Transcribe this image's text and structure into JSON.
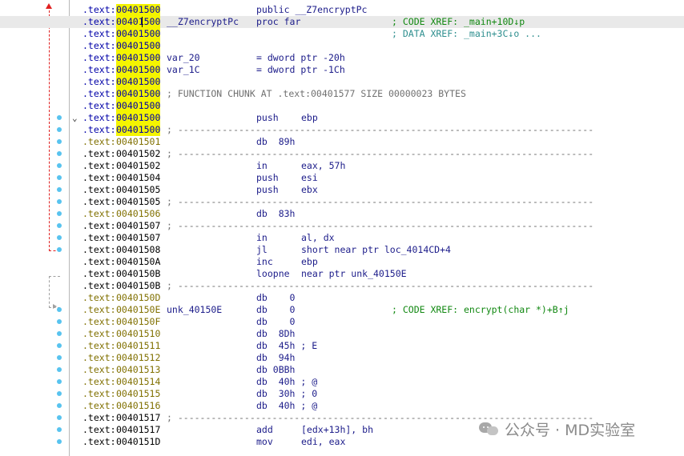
{
  "colors": {
    "highlight": "#f4f400",
    "selected_row": "#e9e9e9",
    "segment_blue": "#0000a8",
    "segment_olive": "#807000",
    "dot": "#58c3ef",
    "flow_arrow": "#e02020"
  },
  "rows": [
    {
      "seg": ".text:",
      "addr": "00401500",
      "hl": true,
      "mn": "public __Z7encryptPc",
      "segc": "blue"
    },
    {
      "seg": ".text:",
      "addr": "00401500",
      "hl": true,
      "sel": true,
      "lbl": "__Z7encryptPc",
      "mn": "proc far",
      "cm": "; CODE XREF: _main+10D↓p",
      "segc": "blue"
    },
    {
      "seg": ".text:",
      "addr": "00401500",
      "hl": true,
      "cm": "; DATA XREF: _main+3C↓o ...",
      "segc": "blue",
      "cmc": "blue"
    },
    {
      "seg": ".text:",
      "addr": "00401500",
      "hl": true,
      "segc": "blue"
    },
    {
      "seg": ".text:",
      "addr": "00401500",
      "hl": true,
      "lbl": "var_20",
      "mn": "= dword ptr -20h",
      "segc": "blue"
    },
    {
      "seg": ".text:",
      "addr": "00401500",
      "hl": true,
      "lbl": "var_1C",
      "mn": "= dword ptr -1Ch",
      "segc": "blue"
    },
    {
      "seg": ".text:",
      "addr": "00401500",
      "hl": true,
      "segc": "blue"
    },
    {
      "seg": ".text:",
      "addr": "00401500",
      "hl": true,
      "sep": "; FUNCTION CHUNK AT .text:00401577 SIZE 00000023 BYTES",
      "segc": "blue"
    },
    {
      "seg": ".text:",
      "addr": "00401500",
      "hl": true,
      "segc": "blue"
    },
    {
      "seg": ".text:",
      "addr": "00401500",
      "hl": true,
      "mn": "push",
      "op": "ebp",
      "segc": "blue"
    },
    {
      "seg": ".text:",
      "addr": "00401500",
      "hl": true,
      "sep": "; ---------------------------------------------------------------------------",
      "segc": "blue"
    },
    {
      "seg": ".text:",
      "addr": "00401501",
      "mn": "db  89h",
      "segc": "olive"
    },
    {
      "seg": ".text:",
      "addr": "00401502",
      "sep": "; ---------------------------------------------------------------------------",
      "segc": "black"
    },
    {
      "seg": ".text:",
      "addr": "00401502",
      "mn": "in",
      "op": "eax, 57h",
      "segc": "black"
    },
    {
      "seg": ".text:",
      "addr": "00401504",
      "mn": "push",
      "op": "esi",
      "segc": "black"
    },
    {
      "seg": ".text:",
      "addr": "00401505",
      "mn": "push",
      "op": "ebx",
      "segc": "black"
    },
    {
      "seg": ".text:",
      "addr": "00401505",
      "sep": "; ---------------------------------------------------------------------------",
      "segc": "black"
    },
    {
      "seg": ".text:",
      "addr": "00401506",
      "mn": "db  83h",
      "segc": "olive"
    },
    {
      "seg": ".text:",
      "addr": "00401507",
      "sep": "; ---------------------------------------------------------------------------",
      "segc": "black"
    },
    {
      "seg": ".text:",
      "addr": "00401507",
      "mn": "in",
      "op": "al, dx",
      "segc": "black"
    },
    {
      "seg": ".text:",
      "addr": "00401508",
      "mn": "jl",
      "op": "short near ptr loc_4014CD+4",
      "segc": "black"
    },
    {
      "seg": ".text:",
      "addr": "0040150A",
      "mn": "inc",
      "op": "ebp",
      "segc": "black"
    },
    {
      "seg": ".text:",
      "addr": "0040150B",
      "mn": "loopne",
      "op": "near ptr unk_40150E",
      "segc": "black"
    },
    {
      "seg": ".text:",
      "addr": "0040150B",
      "sep": "; ---------------------------------------------------------------------------",
      "segc": "black"
    },
    {
      "seg": ".text:",
      "addr": "0040150D",
      "mn": "db    0",
      "segc": "olive"
    },
    {
      "seg": ".text:",
      "addr": "0040150E",
      "lbl": "unk_40150E",
      "mn": "db    0",
      "cm": "; CODE XREF: encrypt(char *)+B↑j",
      "segc": "olive"
    },
    {
      "seg": ".text:",
      "addr": "0040150F",
      "mn": "db    0",
      "segc": "olive"
    },
    {
      "seg": ".text:",
      "addr": "00401510",
      "mn": "db  8Dh",
      "segc": "olive"
    },
    {
      "seg": ".text:",
      "addr": "00401511",
      "mn": "db  45h ; E",
      "segc": "olive"
    },
    {
      "seg": ".text:",
      "addr": "00401512",
      "mn": "db  94h",
      "segc": "olive"
    },
    {
      "seg": ".text:",
      "addr": "00401513",
      "mn": "db 0BBh",
      "segc": "olive"
    },
    {
      "seg": ".text:",
      "addr": "00401514",
      "mn": "db  40h ; @",
      "segc": "olive"
    },
    {
      "seg": ".text:",
      "addr": "00401515",
      "mn": "db  30h ; 0",
      "segc": "olive"
    },
    {
      "seg": ".text:",
      "addr": "00401516",
      "mn": "db  40h ; @",
      "segc": "olive"
    },
    {
      "seg": ".text:",
      "addr": "00401517",
      "sep": "; ---------------------------------------------------------------------------",
      "segc": "black"
    },
    {
      "seg": ".text:",
      "addr": "00401517",
      "mn": "add",
      "op": "[edx+13h], bh",
      "segc": "black"
    },
    {
      "seg": ".text:",
      "addr": "0040151D",
      "mn": "mov",
      "op": "edi, eax",
      "segc": "black"
    }
  ],
  "watermark": {
    "text": "公众号 · MD实验室"
  }
}
